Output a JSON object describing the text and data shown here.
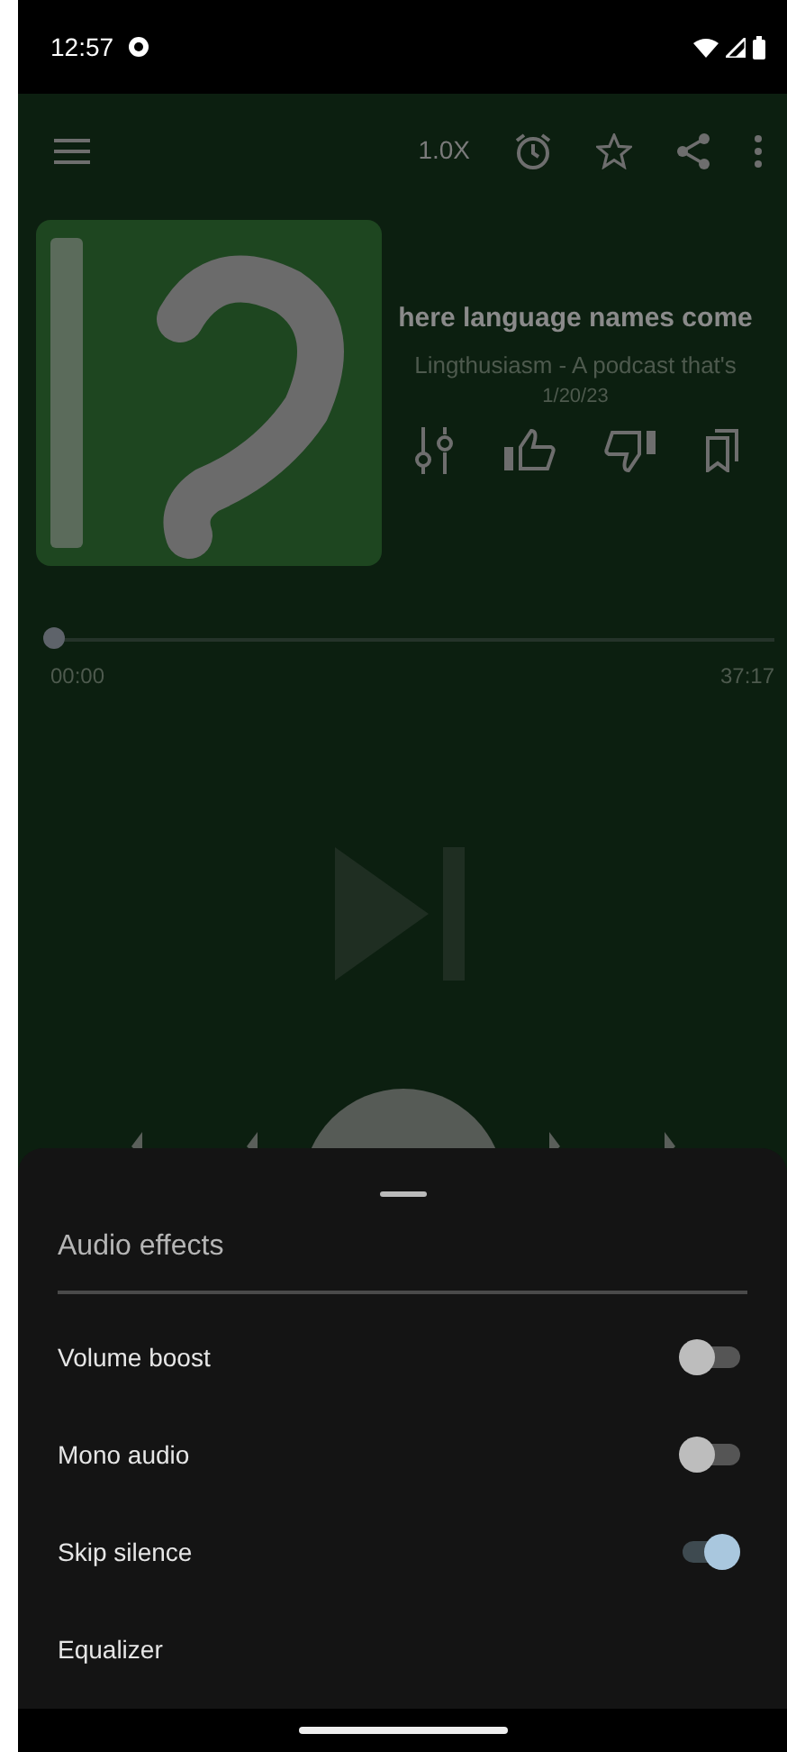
{
  "status_bar": {
    "time": "12:57"
  },
  "toolbar": {
    "speed": "1.0X"
  },
  "episode": {
    "kind": "picture",
    "title": "here language names come",
    "podcast": "Lingthusiasm - A podcast that's",
    "date": "1/20/23"
  },
  "progress": {
    "level": 0,
    "elapsed": "00:00",
    "duration": "37:17"
  },
  "sheet": {
    "title": "Audio effects",
    "items": [
      {
        "label": "Volume boost",
        "kind": "switch",
        "on": false
      },
      {
        "label": "Mono audio",
        "kind": "switch",
        "on": false
      },
      {
        "label": "Skip silence",
        "kind": "switch",
        "on": true
      },
      {
        "label": "Equalizer",
        "kind": "link"
      }
    ]
  }
}
